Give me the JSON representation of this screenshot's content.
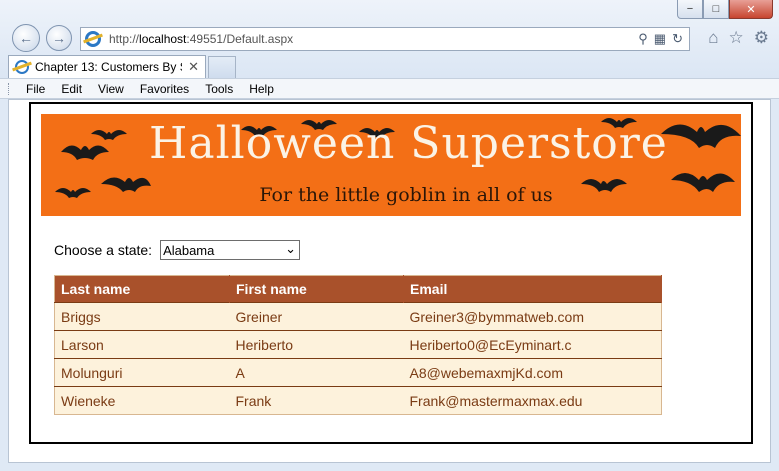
{
  "browser": {
    "url_prefix": "http://",
    "url_host": "localhost",
    "url_rest": ":49551/Default.aspx",
    "tab_title": "Chapter 13: Customers By S...",
    "window_buttons": [
      "−",
      "□",
      "✕"
    ]
  },
  "menu": [
    "File",
    "Edit",
    "View",
    "Favorites",
    "Tools",
    "Help"
  ],
  "banner": {
    "title": "Halloween Superstore",
    "subtitle": "For the little goblin in all of us"
  },
  "state": {
    "label": "Choose a state:",
    "selected": "Alabama"
  },
  "table": {
    "headers": [
      "Last name",
      "First name",
      "Email"
    ],
    "rows": [
      [
        "Briggs",
        "Greiner",
        "Greiner3@bymmatweb.com"
      ],
      [
        "Larson",
        "Heriberto",
        "Heriberto0@EcEyminart.c"
      ],
      [
        "Molunguri",
        "A",
        "A8@webemaxmjKd.com"
      ],
      [
        "Wieneke",
        "Frank",
        "Frank@mastermaxmax.edu"
      ]
    ]
  },
  "colors": {
    "banner_orange": "#f36f16",
    "header_brown": "#a9512b",
    "row_cream": "#fdf2dc",
    "row_text": "#7a3b14"
  }
}
